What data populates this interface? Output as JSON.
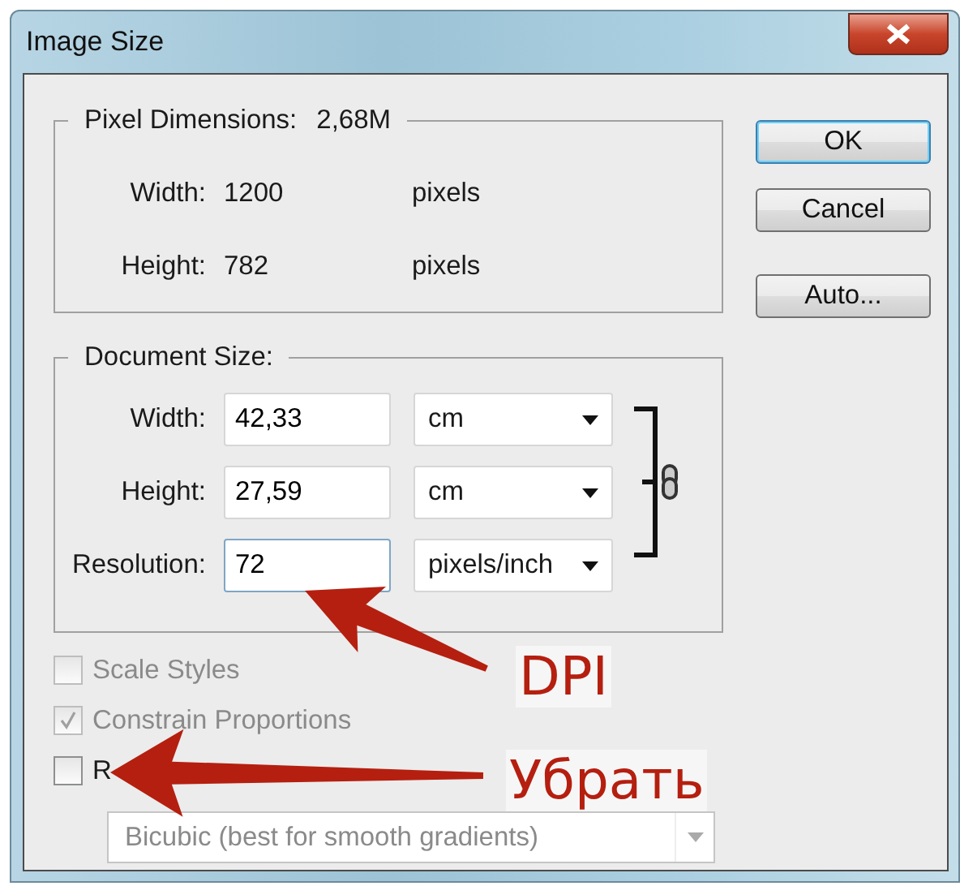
{
  "window": {
    "title": "Image Size"
  },
  "pixel_dimensions": {
    "label": "Pixel Dimensions:",
    "value": "2,68M",
    "rows": [
      {
        "label": "Width:",
        "value": "1200",
        "unit": "pixels"
      },
      {
        "label": "Height:",
        "value": "782",
        "unit": "pixels"
      }
    ]
  },
  "buttons": [
    {
      "label": "OK",
      "default": true
    },
    {
      "label": "Cancel",
      "default": false
    },
    {
      "label": "Auto...",
      "default": false
    }
  ],
  "document_size": {
    "label": "Document Size:",
    "rows": [
      {
        "label": "Width:",
        "value": "42,33",
        "unit": "cm",
        "focused": false
      },
      {
        "label": "Height:",
        "value": "27,59",
        "unit": "cm",
        "focused": false
      },
      {
        "label": "Resolution:",
        "value": "72",
        "unit": "pixels/inch",
        "focused": true
      }
    ]
  },
  "options": [
    {
      "label": "Scale Styles",
      "checked": false,
      "disabled": true
    },
    {
      "label": "Constrain Proportions",
      "checked": true,
      "disabled": true
    },
    {
      "label": "R",
      "checked": false,
      "disabled": false
    }
  ],
  "resample_method": {
    "value": "Bicubic (best for smooth gradients)",
    "disabled": true
  },
  "annotations": [
    {
      "text": "DPI"
    },
    {
      "text": "Убрать"
    }
  ]
}
